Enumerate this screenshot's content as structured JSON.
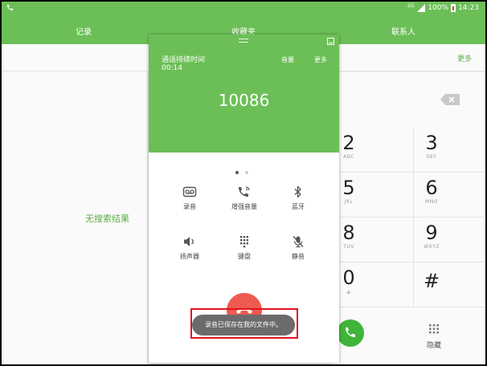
{
  "status_bar": {
    "network": "2G",
    "battery": "100%",
    "time": "14:23"
  },
  "tabs": [
    {
      "label": "记录"
    },
    {
      "label": "收藏夹"
    },
    {
      "label": "联系人"
    }
  ],
  "left_panel": {
    "empty_text": "无搜索结果",
    "more_label": "更多"
  },
  "call_popup": {
    "duration_label": "通话持续时间",
    "duration_value": "00:14",
    "volume_label": "音量",
    "more_label": "更多",
    "number": "10086",
    "controls": [
      {
        "label": "录音",
        "icon": "record-icon"
      },
      {
        "label": "增强音量",
        "icon": "boost-volume-icon"
      },
      {
        "label": "蓝牙",
        "icon": "bluetooth-icon"
      },
      {
        "label": "扬声器",
        "icon": "speaker-icon"
      },
      {
        "label": "键盘",
        "icon": "keypad-icon"
      },
      {
        "label": "静音",
        "icon": "mute-icon"
      }
    ],
    "page_dots": 2,
    "active_dot": 0
  },
  "toast": {
    "text": "录音已保存在我的文件中。"
  },
  "keypad": {
    "keys": [
      {
        "num": "2",
        "sub": "ABC"
      },
      {
        "num": "3",
        "sub": "DEF"
      },
      {
        "num": "5",
        "sub": "JKL"
      },
      {
        "num": "6",
        "sub": "MNO"
      },
      {
        "num": "8",
        "sub": "TUV"
      },
      {
        "num": "9",
        "sub": "WXYZ"
      },
      {
        "num": "0",
        "sub": "+"
      },
      {
        "num": "#",
        "sub": ""
      }
    ],
    "hide_label": "隐藏"
  },
  "colors": {
    "accent": "#6cbf57",
    "end_call": "#ef5a50",
    "call": "#3fb43a",
    "highlight": "#e0141e"
  }
}
